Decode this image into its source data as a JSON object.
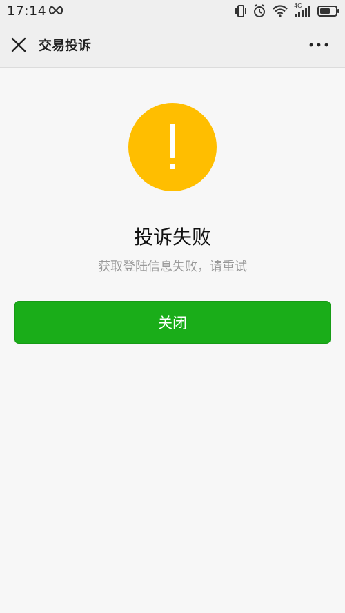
{
  "status_bar": {
    "time": "17:14",
    "icons": [
      "infinity-icon",
      "vibrate-icon",
      "alarm-icon",
      "wifi-icon",
      "cellular-4g-icon",
      "battery-icon"
    ],
    "network_label": "4G"
  },
  "nav": {
    "title": "交易投诉",
    "close_icon": "close-icon",
    "more_icon": "more-icon"
  },
  "result": {
    "icon": "warning-icon",
    "title": "投诉失败",
    "description": "获取登陆信息失败，请重试"
  },
  "actions": {
    "close_label": "关闭"
  },
  "colors": {
    "warning": "#ffbe00",
    "primary_button": "#1aad19",
    "background": "#f7f7f7",
    "bar_background": "#efefef",
    "description_text": "#999999"
  }
}
